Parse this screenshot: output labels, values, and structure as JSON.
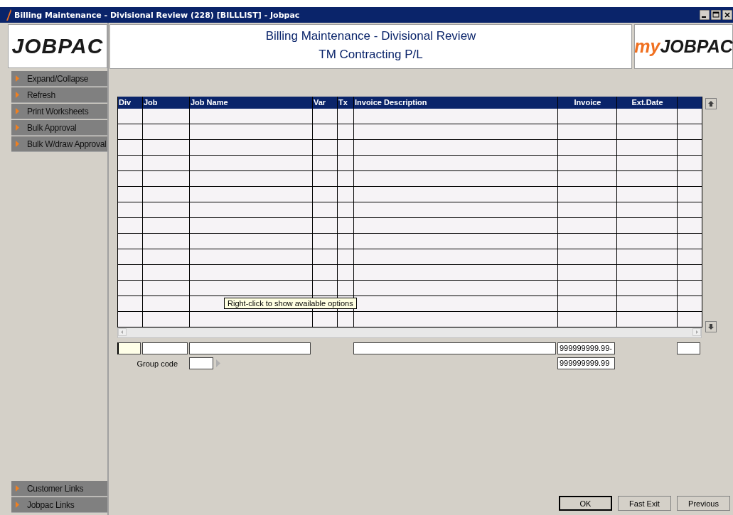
{
  "window": {
    "title": "Billing Maintenance - Divisional Review (228) [BILLLIST] - Jobpac"
  },
  "logo": {
    "text": "JOBPAC"
  },
  "header": {
    "title": "Billing Maintenance - Divisional Review",
    "subtitle": "TM Contracting P/L"
  },
  "brand_logo": {
    "prefix": "my",
    "name": "JOBPAC"
  },
  "sidebar": {
    "items": [
      {
        "label": "Expand/Collapse"
      },
      {
        "label": "Refresh"
      },
      {
        "label": "Print Worksheets"
      },
      {
        "label": "Bulk Approval"
      },
      {
        "label": "Bulk W/draw Approval"
      }
    ],
    "bottom_items": [
      {
        "label": "Customer Links"
      },
      {
        "label": "Jobpac Links"
      }
    ]
  },
  "table": {
    "columns": [
      "Div",
      "Job",
      "Job Name",
      "Var",
      "Tx",
      "Invoice Description",
      "Invoice",
      "Ext.Date"
    ]
  },
  "tooltip": "Right-click to show available options",
  "entry_fields": [
    {
      "focused": true
    },
    {
      "focused": false
    },
    {
      "focused": false
    },
    {
      "focused": false
    },
    {
      "focused": false,
      "value": "999999999.99-"
    },
    {
      "focused": false
    }
  ],
  "group_code": {
    "label": "Group code"
  },
  "total": "999999999.99",
  "buttons": [
    "OK",
    "Fast Exit",
    "Previous"
  ]
}
